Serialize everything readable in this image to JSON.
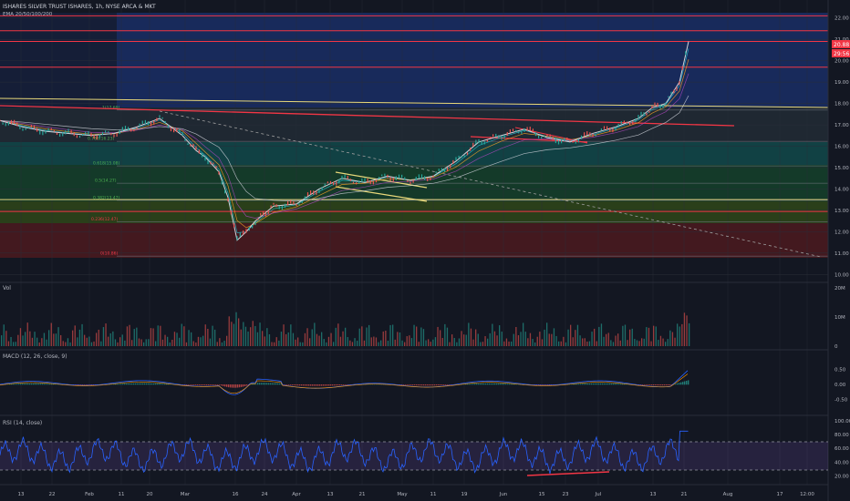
{
  "header": {
    "title": "ISHARES SILVER TRUST ISHARES, 1h, NYSE ARCA & MKT",
    "indicator": "EMA 20/50/100/200"
  },
  "price_labels": {
    "last": "20.88",
    "countdown": "29:56"
  },
  "panes": {
    "volume": {
      "label": "Vol"
    },
    "macd": {
      "label": "MACD (12, 26, close, 9)"
    },
    "rsi": {
      "label": "RSI (14, close)"
    }
  },
  "colors": {
    "background": "#131722",
    "candle_up": "#26a69a",
    "candle_down": "#ef5350",
    "line_red": "#f23645",
    "line_yellow": "#e8d87a",
    "rsi_line": "#2962ff",
    "rsi_band": "#7e57c2",
    "macd_line": "#2962ff",
    "fib_zone_1": "#1e3a8a",
    "fib_zone_2": "#0f766e",
    "fib_zone_3": "#166534",
    "fib_zone_4": "#4d7c0f",
    "fib_zone_5": "#7f1d1d"
  },
  "chart_data": [
    {
      "type": "line",
      "name": "price",
      "x_ticks": [
        "13",
        "22",
        "Feb",
        "11",
        "20",
        "Mar",
        "16",
        "24",
        "Apr",
        "13",
        "21",
        "May",
        "11",
        "19",
        "Jun",
        "15",
        "23",
        "Jul",
        "13",
        "21",
        "Aug",
        "17",
        "12:00"
      ],
      "y_ticks": [
        "22.00",
        "21.00",
        "20.00",
        "19.00",
        "18.00",
        "17.00",
        "16.00",
        "15.00",
        "14.00",
        "13.00",
        "12.00",
        "11.00",
        "10.00"
      ],
      "ylim": [
        9.8,
        22.5
      ],
      "x": [
        0,
        25,
        50,
        75,
        100,
        125,
        150,
        175,
        200,
        215,
        225,
        240,
        250,
        260,
        270,
        280,
        300,
        325,
        350,
        375,
        400,
        425,
        450,
        475,
        500,
        525,
        550,
        575,
        600,
        625,
        650,
        675,
        700,
        715,
        730,
        745,
        755
      ],
      "y": [
        17.2,
        16.9,
        16.7,
        16.6,
        16.5,
        16.6,
        16.9,
        17.3,
        16.5,
        15.8,
        15.5,
        14.8,
        13.6,
        11.6,
        12.0,
        12.5,
        13.2,
        13.3,
        14.0,
        14.5,
        14.3,
        14.6,
        14.4,
        14.6,
        15.3,
        16.2,
        16.5,
        16.8,
        16.4,
        16.2,
        16.6,
        16.9,
        17.3,
        17.8,
        18.0,
        19.0,
        20.9
      ],
      "horizontal_levels": [
        {
          "value": 22.1,
          "color": "red"
        },
        {
          "value": 21.4,
          "color": "red"
        },
        {
          "value": 20.9,
          "color": "red"
        },
        {
          "value": 19.7,
          "color": "red"
        },
        {
          "value": 12.95,
          "color": "red"
        },
        {
          "value": 13.5,
          "color": "yellow"
        }
      ],
      "fib_levels": [
        {
          "label": "1(17.69)",
          "value": 17.69
        },
        {
          "label": "0.786(16.23)",
          "value": 16.23
        },
        {
          "label": "0.618(15.08)",
          "value": 15.08
        },
        {
          "label": "0.5(14.27)",
          "value": 14.27
        },
        {
          "label": "0.382(13.47)",
          "value": 13.47
        },
        {
          "label": "0.236(12.47)",
          "value": 12.47
        },
        {
          "label": "0(10.86)",
          "value": 10.86
        }
      ]
    },
    {
      "type": "bar",
      "name": "volume",
      "y_ticks": [
        "20M",
        "10M",
        "0"
      ],
      "ylim": [
        0,
        20
      ]
    },
    {
      "type": "line",
      "name": "macd",
      "y_ticks": [
        "0.50",
        "0.00",
        "-0.50"
      ],
      "ylim": [
        -0.9,
        0.9
      ]
    },
    {
      "type": "line",
      "name": "rsi",
      "y_ticks": [
        "100.00",
        "80.00",
        "60.00",
        "40.00",
        "20.00"
      ],
      "ylim": [
        10,
        100
      ],
      "bands": [
        30,
        70
      ]
    }
  ]
}
